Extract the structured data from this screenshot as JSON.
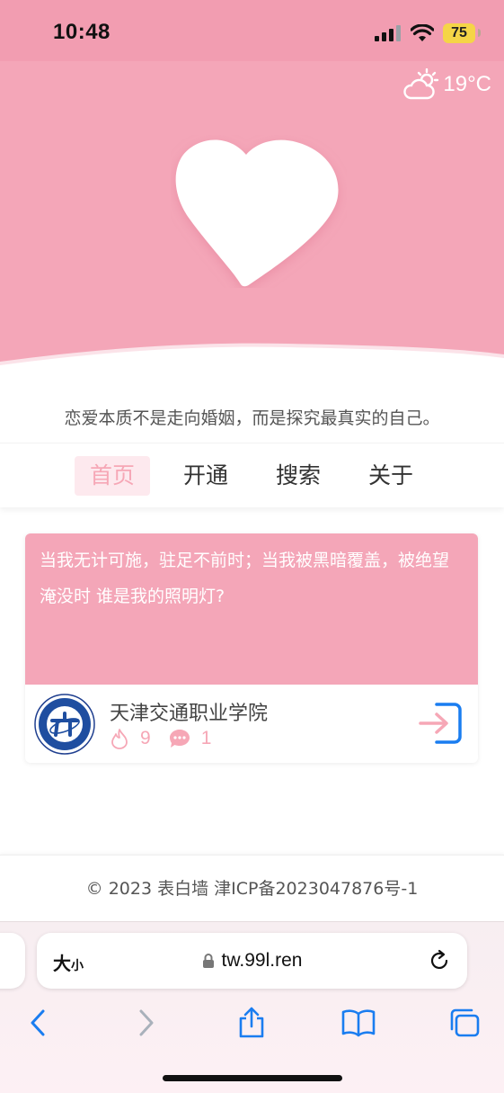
{
  "status_bar": {
    "time": "10:48",
    "battery": "75"
  },
  "hero": {
    "weather_temp": "19°C"
  },
  "motto": "恋爱本质不是走向婚姻，而是探究最真实的自己。",
  "nav": {
    "items": [
      {
        "label": "首页",
        "active": true
      },
      {
        "label": "开通",
        "active": false
      },
      {
        "label": "搜索",
        "active": false
      },
      {
        "label": "关于",
        "active": false
      }
    ]
  },
  "card": {
    "content": "当我无计可施，驻足不前时；当我被黑暗覆盖，被绝望淹没时 谁是我的照明灯?",
    "school": "天津交通职业学院",
    "likes": "9",
    "comments": "1"
  },
  "footer": {
    "text": "© 2023 表白墙  津ICP备2023047876号-1"
  },
  "safari": {
    "text_size_big": "大",
    "text_size_small": "小",
    "url": "tw.99l.ren"
  },
  "colors": {
    "brand_pink": "#f4a6b8",
    "accent_pink": "#f6a7b6",
    "ios_blue": "#1a7df0"
  }
}
